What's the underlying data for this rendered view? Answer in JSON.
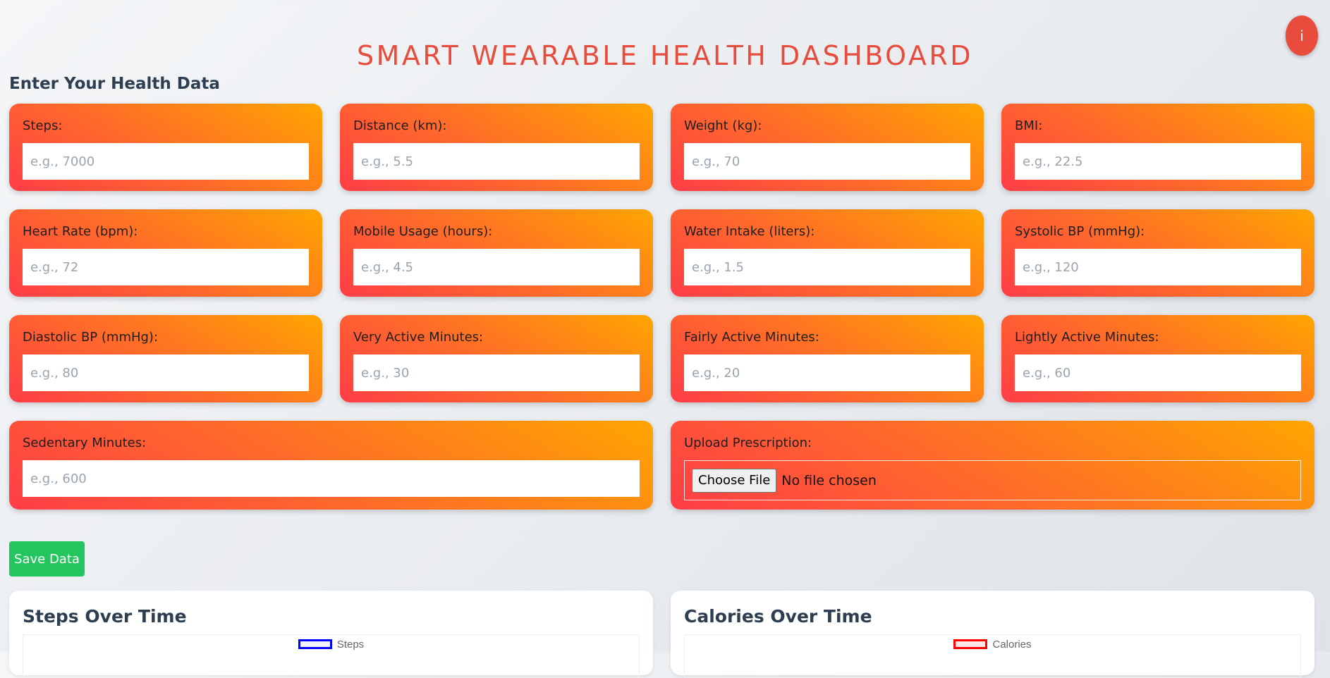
{
  "header": {
    "title": "SMART WEARABLE HEALTH DASHBOARD",
    "info_label": "i"
  },
  "form": {
    "heading": "Enter Your Health Data",
    "fields": [
      {
        "label": "Steps:",
        "placeholder": "e.g., 7000"
      },
      {
        "label": "Distance (km):",
        "placeholder": "e.g., 5.5"
      },
      {
        "label": "Weight (kg):",
        "placeholder": "e.g., 70"
      },
      {
        "label": "BMI:",
        "placeholder": "e.g., 22.5"
      },
      {
        "label": "Heart Rate (bpm):",
        "placeholder": "e.g., 72"
      },
      {
        "label": "Mobile Usage (hours):",
        "placeholder": "e.g., 4.5"
      },
      {
        "label": "Water Intake (liters):",
        "placeholder": "e.g., 1.5"
      },
      {
        "label": "Systolic BP (mmHg):",
        "placeholder": "e.g., 120"
      },
      {
        "label": "Diastolic BP (mmHg):",
        "placeholder": "e.g., 80"
      },
      {
        "label": "Very Active Minutes:",
        "placeholder": "e.g., 30"
      },
      {
        "label": "Fairly Active Minutes:",
        "placeholder": "e.g., 20"
      },
      {
        "label": "Lightly Active Minutes:",
        "placeholder": "e.g., 60"
      },
      {
        "label": "Sedentary Minutes:",
        "placeholder": "e.g., 600"
      }
    ],
    "upload": {
      "label": "Upload Prescription:",
      "button_label": "Choose File",
      "status": "No file chosen"
    },
    "save_label": "Save Data"
  },
  "charts": [
    {
      "title": "Steps Over Time",
      "legend_label": "Steps",
      "legend_color": "#0000ff",
      "legend_fill": "rgba(0,0,255,0.06)"
    },
    {
      "title": "Calories Over Time",
      "legend_label": "Calories",
      "legend_color": "#ff0000",
      "legend_fill": "rgba(255,0,0,0.1)"
    }
  ],
  "colors": {
    "accent": "#e74c3c",
    "save": "#22c55e"
  }
}
